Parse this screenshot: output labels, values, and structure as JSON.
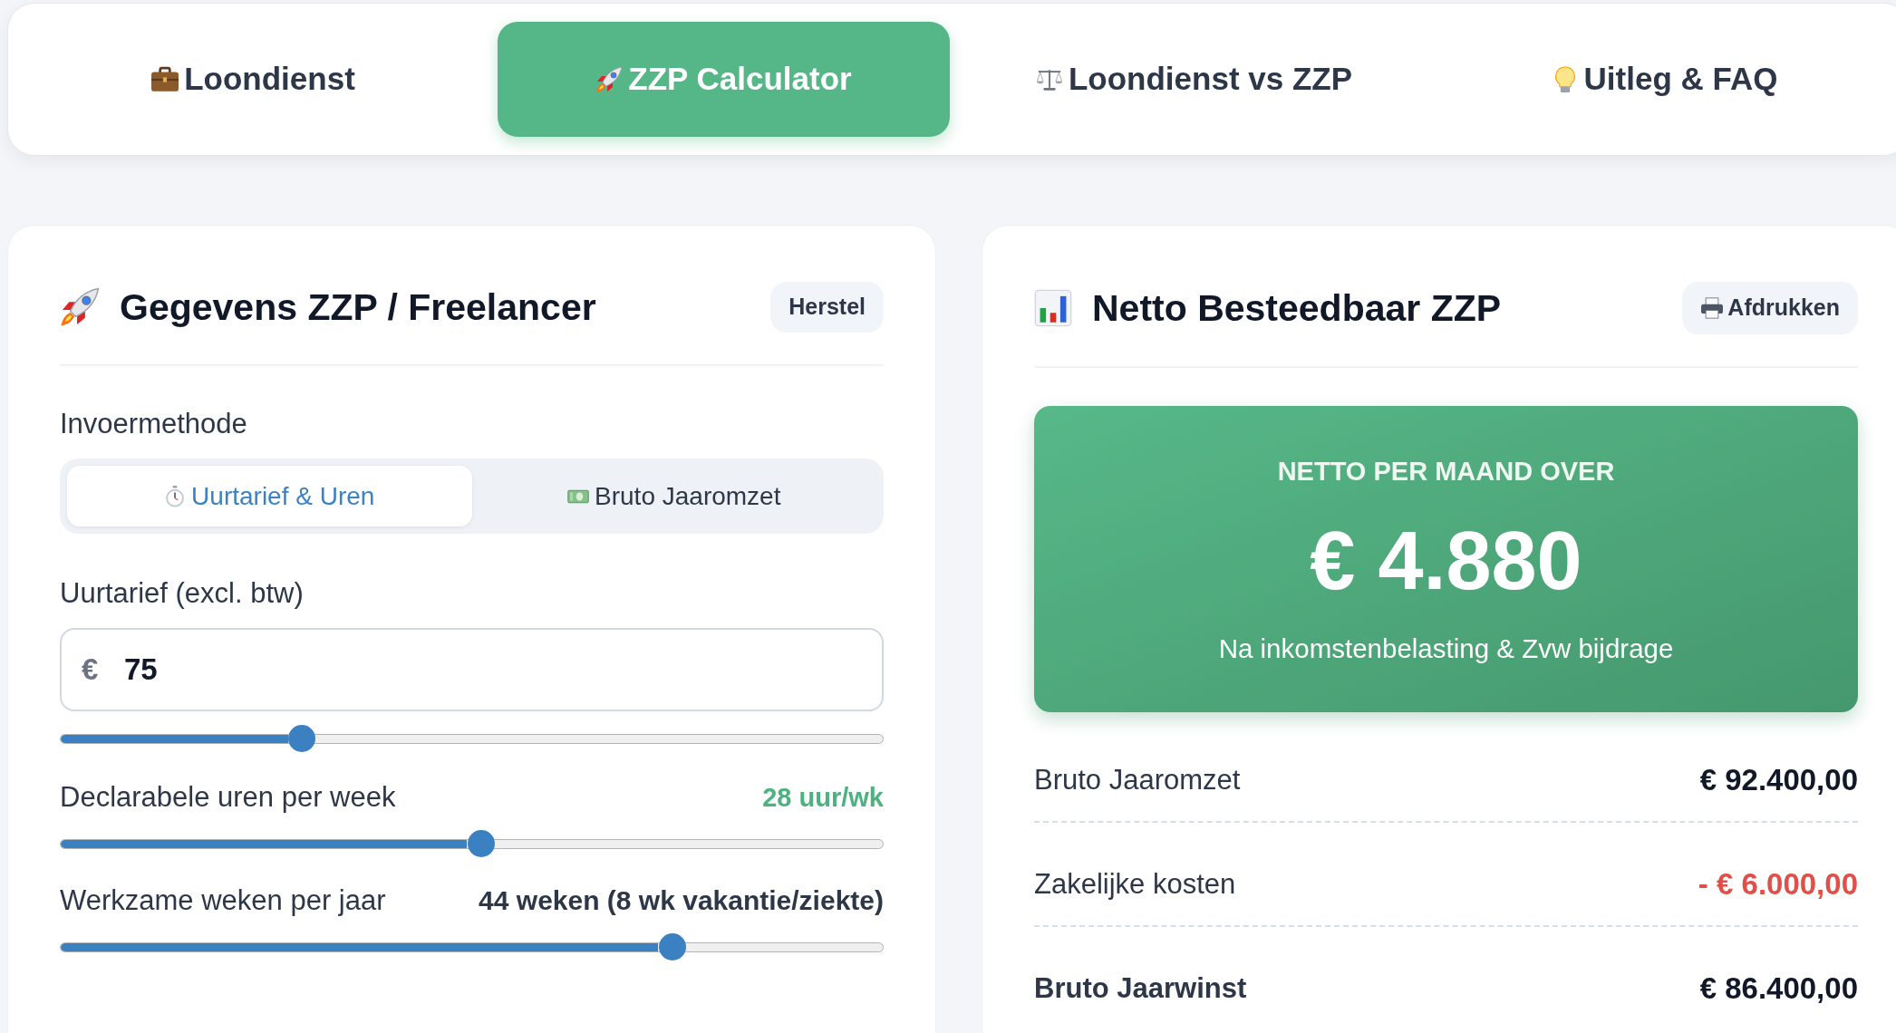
{
  "nav_tabs": [
    {
      "label": "Loondienst",
      "selected": false
    },
    {
      "label": "ZZP Calculator",
      "selected": true
    },
    {
      "label": "Loondienst vs ZZP",
      "selected": false
    },
    {
      "label": "Uitleg & FAQ",
      "selected": false
    }
  ],
  "input_panel": {
    "title": "Gegevens ZZP / Freelancer",
    "reset_button": "Herstel",
    "input_method": {
      "label": "Invoermethode",
      "options": [
        {
          "label": "Uurtarief & Uren",
          "selected": true
        },
        {
          "label": "Bruto Jaaromzet",
          "selected": false
        }
      ]
    },
    "hourly_rate": {
      "label": "Uurtarief (excl. btw)",
      "prefix": "€",
      "value": "75",
      "level": 0.294
    },
    "billable_hours": {
      "label": "Declarabele uren per week",
      "reading": "28 uur/wk",
      "level": 0.512
    },
    "work_weeks": {
      "label": "Werkzame weken per jaar",
      "reading": "44 weken (8 wk vakantie/ziekte)",
      "level": 0.744
    }
  },
  "result_panel": {
    "title": "Netto Besteedbaar ZZP",
    "print_button": "Afdrukken",
    "summary": {
      "caption": "NETTO PER MAAND OVER",
      "amount": "€ 4.880",
      "note": "Na inkomstenbelasting & Zvw bijdrage"
    },
    "rows": [
      {
        "label": "Bruto Jaaromzet",
        "value": "€ 92.400,00",
        "kind": "normal"
      },
      {
        "label": "Zakelijke kosten",
        "value": "- € 6.000,00",
        "kind": "deduction"
      },
      {
        "label": "Bruto Jaarwinst",
        "value": "€ 86.400,00",
        "kind": "total"
      }
    ]
  }
}
